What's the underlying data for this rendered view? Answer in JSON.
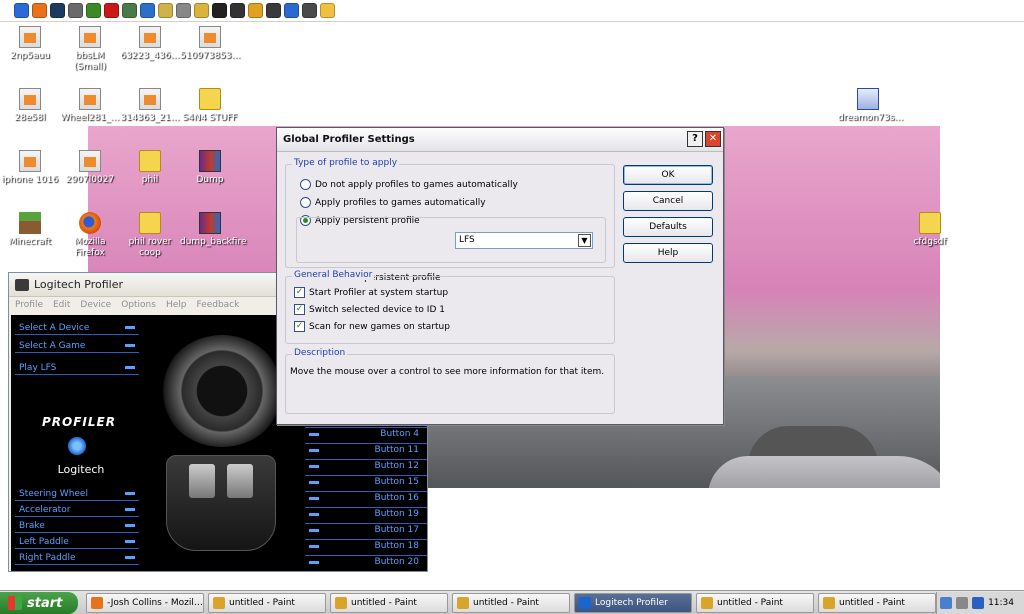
{
  "quicklaunch": {
    "icons": [
      "internet-explorer-icon",
      "firefox-icon",
      "steam-icon",
      "app-icon",
      "minecraft-icon",
      "ati-icon",
      "app-icon",
      "network-icon",
      "drive-icon",
      "window-icon",
      "disk-icon",
      "link-icon",
      "gear-icon",
      "media-icon",
      "game-icon",
      "chat-icon",
      "edit-icon",
      "folder-icon"
    ]
  },
  "desktop": {
    "icons": [
      {
        "label": "2np5auu",
        "type": "file"
      },
      {
        "label": "bbsLM (Small)",
        "type": "file"
      },
      {
        "label": "63223_436…",
        "type": "file"
      },
      {
        "label": "510973853…",
        "type": "file"
      },
      {
        "label": "28e58l",
        "type": "file"
      },
      {
        "label": "Wheel281_…",
        "type": "file"
      },
      {
        "label": "314363_21…",
        "type": "file"
      },
      {
        "label": "S4N4 STUFF",
        "type": "folder"
      },
      {
        "label": "dreamon73s…",
        "type": "dream"
      },
      {
        "label": "iphone 1016",
        "type": "file"
      },
      {
        "label": "2907l0027",
        "type": "file"
      },
      {
        "label": "phil",
        "type": "folder"
      },
      {
        "label": "Dump",
        "type": "rar"
      },
      {
        "label": "Minecraft",
        "type": "mc"
      },
      {
        "label": "Mozilla Firefox",
        "type": "ff"
      },
      {
        "label": "phil rover coop",
        "type": "folder"
      },
      {
        "label": "dump_backfire",
        "type": "rar"
      },
      {
        "label": "cfdgsdf",
        "type": "folder"
      }
    ]
  },
  "logitech": {
    "title": "Logitech Profiler",
    "menu": [
      "Profile",
      "Edit",
      "Device",
      "Options",
      "Help",
      "Feedback"
    ],
    "left_items_top": [
      "Select A Device",
      "Select A Game",
      "Play LFS"
    ],
    "logo": {
      "profiler": "PROFILER",
      "brand": "Logitech"
    },
    "left_items_bottom": [
      "Steering Wheel",
      "Accelerator",
      "Brake",
      "Left Paddle",
      "Right Paddle"
    ],
    "buttons": [
      "Button 4",
      "Button 11",
      "Button 12",
      "Button 15",
      "Button 16",
      "Button 19",
      "Button 17",
      "Button 18",
      "Button 20"
    ]
  },
  "dialog": {
    "title": "Global Profiler Settings",
    "help_glyph": "?",
    "close_glyph": "✕",
    "profile_group": {
      "title": "Type of profile to apply",
      "options": [
        "Do not apply profiles to games automatically",
        "Apply profiles to games automatically",
        "Apply persistent profile"
      ],
      "selected_index": 2,
      "persistent_label": "Choose persistent profile",
      "persistent_value": "LFS"
    },
    "behavior_group": {
      "title": "General Behavior",
      "options": [
        {
          "label": "Start Profiler at system startup",
          "checked": true
        },
        {
          "label": "Switch selected device to ID 1",
          "checked": true
        },
        {
          "label": "Scan for new games on startup",
          "checked": true
        }
      ]
    },
    "description_group": {
      "title": "Description",
      "text": "Move the mouse over a control to see more information for that item."
    },
    "buttons": {
      "ok": "OK",
      "cancel": "Cancel",
      "defaults": "Defaults",
      "help": "Help"
    }
  },
  "taskbar": {
    "start": "start",
    "items": [
      {
        "label": "-Josh Collins - Mozil…",
        "icon": "firefox-icon",
        "active": false
      },
      {
        "label": "untitled - Paint",
        "icon": "paint-icon",
        "active": false
      },
      {
        "label": "untitled - Paint",
        "icon": "paint-icon",
        "active": false
      },
      {
        "label": "untitled - Paint",
        "icon": "paint-icon",
        "active": false
      },
      {
        "label": "Logitech Profiler",
        "icon": "logitech-icon",
        "active": true
      },
      {
        "label": "untitled - Paint",
        "icon": "paint-icon",
        "active": false
      },
      {
        "label": "untitled - Paint",
        "icon": "paint-icon",
        "active": false
      }
    ],
    "clock": "11:34"
  },
  "colors": {
    "accent": "#2a5bc0",
    "link": "#5aa0ff",
    "group_title": "#1a3fb8",
    "start_green": "#287a28"
  }
}
